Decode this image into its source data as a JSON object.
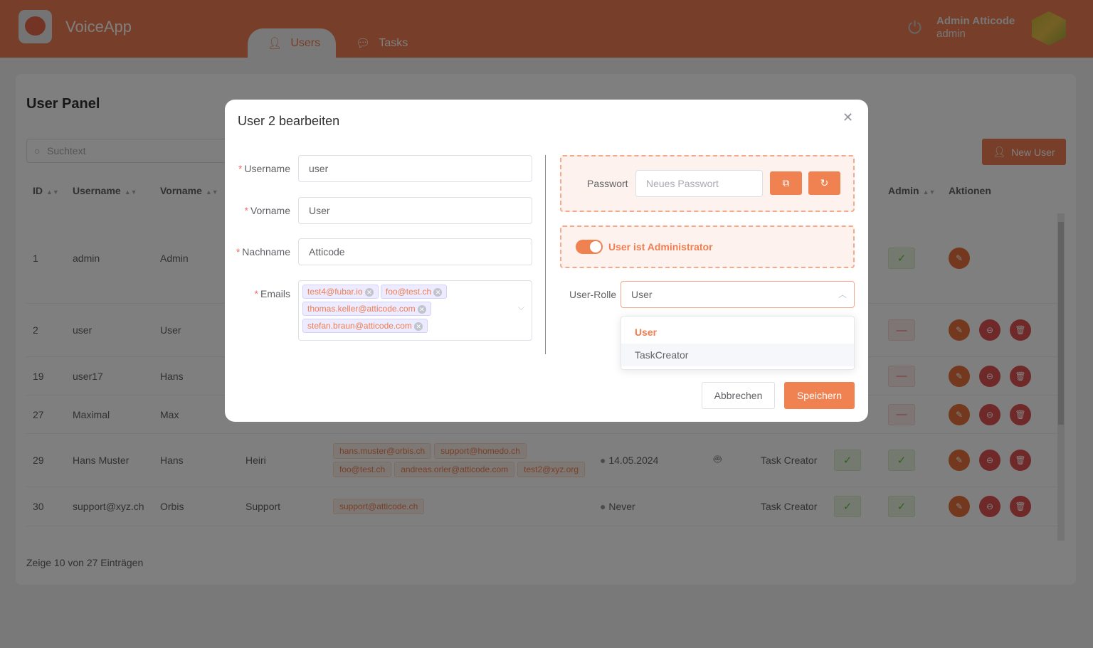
{
  "app": {
    "name": "VoiceApp",
    "logo_icon": "microphone-bubble-icon"
  },
  "nav": {
    "tabs": [
      {
        "label": "Users",
        "icon": "user-icon",
        "active": true
      },
      {
        "label": "Tasks",
        "icon": "chat-icon",
        "active": false
      }
    ]
  },
  "user": {
    "name": "Admin Atticode",
    "role": "admin"
  },
  "panel": {
    "title": "User Panel",
    "search_placeholder": "Suchtext",
    "new_user": "New User",
    "footer": "Zeige 10 von 27 Einträgen"
  },
  "columns": {
    "id": "ID",
    "username": "Username",
    "vorname": "Vorname",
    "admin": "Admin",
    "actions": "Aktionen"
  },
  "rows": [
    {
      "id": "1",
      "username": "admin",
      "vorname": "Admin",
      "nachname": "",
      "emails": [],
      "last_login": "",
      "device": false,
      "role": "",
      "active": null,
      "admin": true,
      "actions": [
        "edit"
      ]
    },
    {
      "id": "2",
      "username": "user",
      "vorname": "User",
      "nachname": "",
      "emails": [],
      "last_login": "",
      "device": false,
      "role": "",
      "active": null,
      "admin": false,
      "actions": [
        "edit",
        "remove-user",
        "delete"
      ]
    },
    {
      "id": "19",
      "username": "user17",
      "vorname": "Hans",
      "nachname": "",
      "emails": [],
      "last_login": "",
      "device": false,
      "role": "",
      "active": null,
      "admin": false,
      "actions": [
        "edit",
        "remove-user",
        "delete"
      ]
    },
    {
      "id": "27",
      "username": "Maximal",
      "vorname": "Max",
      "nachname": "",
      "emails": [],
      "last_login": "",
      "device": false,
      "role": "",
      "active": null,
      "admin": false,
      "actions": [
        "edit",
        "remove-user",
        "delete"
      ]
    },
    {
      "id": "29",
      "username": "Hans Muster",
      "vorname": "Hans",
      "nachname": "Heiri",
      "emails": [
        "hans.muster@orbis.ch",
        "support@homedo.ch",
        "foo@test.ch",
        "andreas.orler@atticode.com",
        "test2@xyz.org"
      ],
      "last_login": "14.05.2024",
      "device": true,
      "role": "Task Creator",
      "active": true,
      "admin": true,
      "actions": [
        "edit",
        "remove-user",
        "delete"
      ]
    },
    {
      "id": "30",
      "username": "support@xyz.ch",
      "vorname": "Orbis",
      "nachname": "Support",
      "emails": [
        "support@atticode.ch"
      ],
      "last_login": "Never",
      "device": false,
      "role": "Task Creator",
      "active": true,
      "admin": true,
      "actions": [
        "edit",
        "remove-user",
        "delete"
      ]
    }
  ],
  "modal": {
    "title": "User 2 bearbeiten",
    "fields": {
      "username": {
        "label": "Username",
        "value": "user"
      },
      "vorname": {
        "label": "Vorname",
        "value": "User"
      },
      "nachname": {
        "label": "Nachname",
        "value": "Atticode"
      },
      "emails": {
        "label": "Emails",
        "values": [
          "test4@fubar.io",
          "foo@test.ch",
          "thomas.keller@atticode.com",
          "stefan.braun@atticode.com"
        ]
      }
    },
    "password": {
      "label": "Passwort",
      "placeholder": "Neues Passwort"
    },
    "admin_toggle": {
      "label": "User ist Administrator",
      "on": true
    },
    "role": {
      "label": "User-Rolle",
      "value": "User",
      "options": [
        "User",
        "TaskCreator"
      ]
    },
    "cancel": "Abbrechen",
    "save": "Speichern"
  },
  "colors": {
    "brand": "#ef7e52",
    "success": "#67c23a",
    "danger": "#e05252"
  }
}
